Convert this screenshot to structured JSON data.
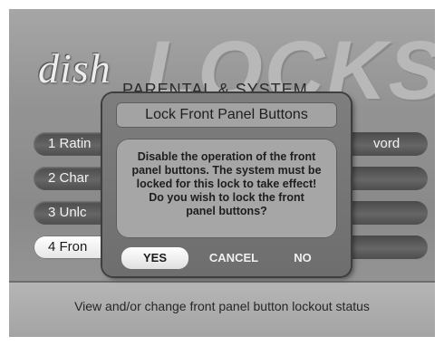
{
  "header": {
    "logo_text": "dish",
    "big_title": "LOCKS",
    "subtitle": "PARENTAL & SYSTEM"
  },
  "menu": {
    "items": [
      {
        "label": "1 Ratin"
      },
      {
        "label": "2 Char"
      },
      {
        "label": "3 Unlc"
      },
      {
        "label": "4 Fron",
        "selected": true
      }
    ],
    "right_items": [
      {
        "label": "vord"
      },
      {
        "label": ""
      },
      {
        "label": ""
      },
      {
        "label": ""
      }
    ]
  },
  "dialog": {
    "title": "Lock Front Panel Buttons",
    "lines": [
      "Disable the operation of the front",
      "panel buttons. The system must be",
      "locked for this lock to take effect!",
      "Do you wish to lock the front",
      "panel buttons?"
    ],
    "buttons": {
      "yes": "YES",
      "cancel": "CANCEL",
      "no": "NO"
    },
    "selected_button": "yes"
  },
  "status": {
    "text": "View and/or change front panel button lockout status"
  },
  "colors": {
    "background": "#8f8f8f",
    "pill": "#5a5a5a",
    "selected": "#ffffff",
    "dialog": "#767676"
  }
}
